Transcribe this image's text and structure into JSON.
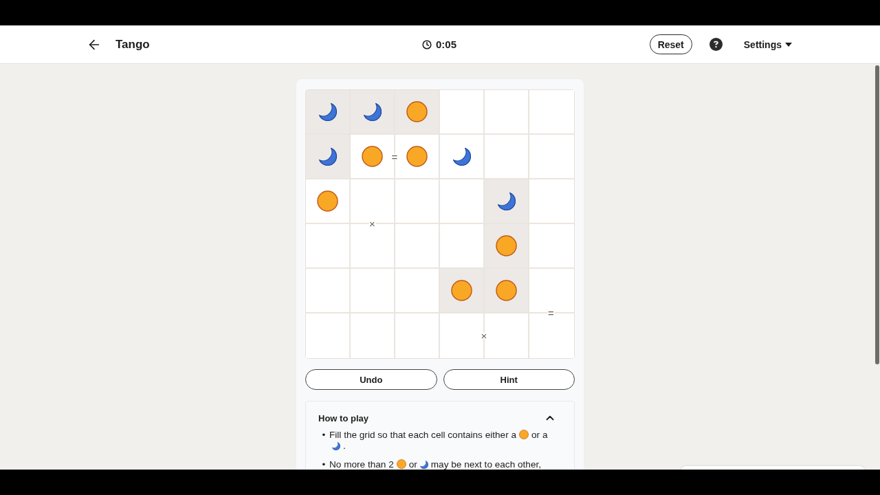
{
  "header": {
    "title": "Tango",
    "timer": "0:05",
    "reset_button": "Reset",
    "settings_menu": "Settings"
  },
  "board": {
    "rows": [
      [
        {
          "kind": "moon",
          "locked": true
        },
        {
          "kind": "moon",
          "locked": true
        },
        {
          "kind": "sun",
          "locked": true
        },
        {
          "kind": "empty",
          "locked": false
        },
        {
          "kind": "empty",
          "locked": false
        },
        {
          "kind": "empty",
          "locked": false
        }
      ],
      [
        {
          "kind": "moon",
          "locked": true
        },
        {
          "kind": "sun",
          "locked": false,
          "right": "="
        },
        {
          "kind": "sun",
          "locked": false
        },
        {
          "kind": "moon",
          "locked": false
        },
        {
          "kind": "empty",
          "locked": false
        },
        {
          "kind": "empty",
          "locked": false
        }
      ],
      [
        {
          "kind": "sun",
          "locked": false
        },
        {
          "kind": "empty",
          "locked": false,
          "bottom": "×"
        },
        {
          "kind": "empty",
          "locked": false
        },
        {
          "kind": "empty",
          "locked": false
        },
        {
          "kind": "moon",
          "locked": true
        },
        {
          "kind": "empty",
          "locked": false
        }
      ],
      [
        {
          "kind": "empty",
          "locked": false
        },
        {
          "kind": "empty",
          "locked": false
        },
        {
          "kind": "empty",
          "locked": false
        },
        {
          "kind": "empty",
          "locked": false
        },
        {
          "kind": "sun",
          "locked": true
        },
        {
          "kind": "empty",
          "locked": false
        }
      ],
      [
        {
          "kind": "empty",
          "locked": false
        },
        {
          "kind": "empty",
          "locked": false
        },
        {
          "kind": "empty",
          "locked": false
        },
        {
          "kind": "sun",
          "locked": true
        },
        {
          "kind": "sun",
          "locked": true
        },
        {
          "kind": "empty",
          "locked": false,
          "bottom": "="
        }
      ],
      [
        {
          "kind": "empty",
          "locked": false
        },
        {
          "kind": "empty",
          "locked": false
        },
        {
          "kind": "empty",
          "locked": false
        },
        {
          "kind": "empty",
          "locked": false,
          "right": "×"
        },
        {
          "kind": "empty",
          "locked": false
        },
        {
          "kind": "empty",
          "locked": false
        }
      ]
    ]
  },
  "actions": [
    "Undo",
    "Hint"
  ],
  "how_to_play": {
    "title": "How to play",
    "expanded": true,
    "rules": [
      {
        "bullet": "•",
        "segments": [
          {
            "kind": "text",
            "text": "Fill the grid so that each cell contains either a"
          },
          {
            "kind": "sun"
          },
          {
            "kind": "text",
            "text": "or a"
          },
          {
            "kind": "moon"
          },
          {
            "kind": "text",
            "text": "."
          }
        ]
      },
      {
        "bullet": "•",
        "segments": [
          {
            "kind": "text",
            "text": "No more than 2"
          },
          {
            "kind": "sun"
          },
          {
            "kind": "text",
            "text": "or"
          },
          {
            "kind": "moon"
          },
          {
            "kind": "text",
            "text": "may be next to each other,"
          }
        ]
      }
    ]
  }
}
